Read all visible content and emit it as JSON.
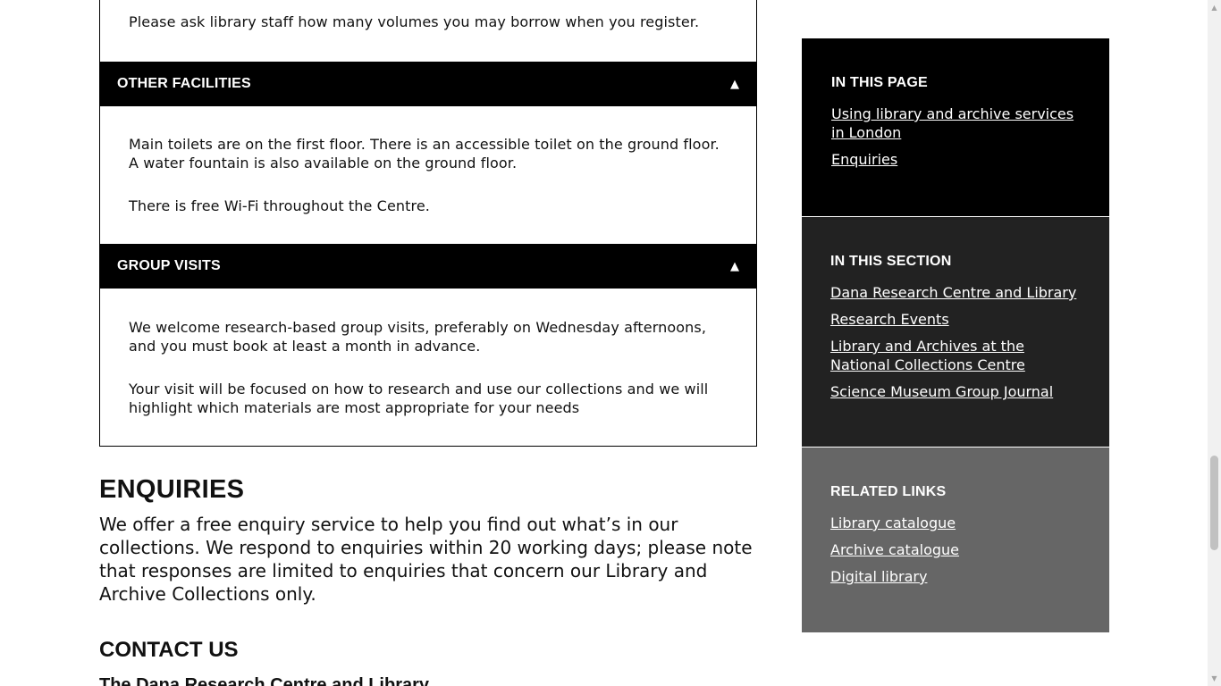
{
  "accordion": {
    "intro_text": "Please ask library staff how many volumes you may borrow when you register.",
    "sections": [
      {
        "title": "OTHER FACILITIES",
        "arrow": "▲",
        "paragraphs": [
          "Main toilets are on the first floor. There is an accessible toilet on the ground floor. A water fountain is also available on the ground floor.",
          "There is free Wi-Fi throughout the Centre."
        ]
      },
      {
        "title": "GROUP VISITS",
        "arrow": "▲",
        "paragraphs": [
          "We welcome research-based group visits, preferably on Wednesday afternoons, and you must book at least a month in advance.",
          "Your visit will be focused on how to research and use our collections and we will highlight which materials are most appropriate for your needs"
        ]
      }
    ]
  },
  "enquiries": {
    "heading": "ENQUIRIES",
    "text": "We offer a free enquiry service to help you find out what’s in our collections. We respond to enquiries within 20 working days; please note that responses are limited to enquiries that concern our Library and Archive Collections only."
  },
  "contact": {
    "heading": "CONTACT US",
    "subheading": "The Dana Research Centre and Library"
  },
  "sidebar": {
    "in_this_page": {
      "heading": "IN THIS PAGE",
      "links": [
        "Using library and archive services in London",
        "Enquiries"
      ]
    },
    "in_this_section": {
      "heading": "IN THIS SECTION",
      "links": [
        "Dana Research Centre and Library",
        "Research Events",
        "Library and Archives at the National Collections Centre",
        "Science Museum Group Journal"
      ]
    },
    "related_links": {
      "heading": "RELATED LINKS",
      "links": [
        "Library catalogue",
        "Archive catalogue",
        "Digital library"
      ]
    }
  },
  "colors": {
    "accordion_header": "#000000",
    "sidebar_page": "#000000",
    "sidebar_section": "#222222",
    "sidebar_related": "#666666"
  },
  "scrollbar": {
    "up_icon": "▲",
    "down_icon": "▼"
  }
}
